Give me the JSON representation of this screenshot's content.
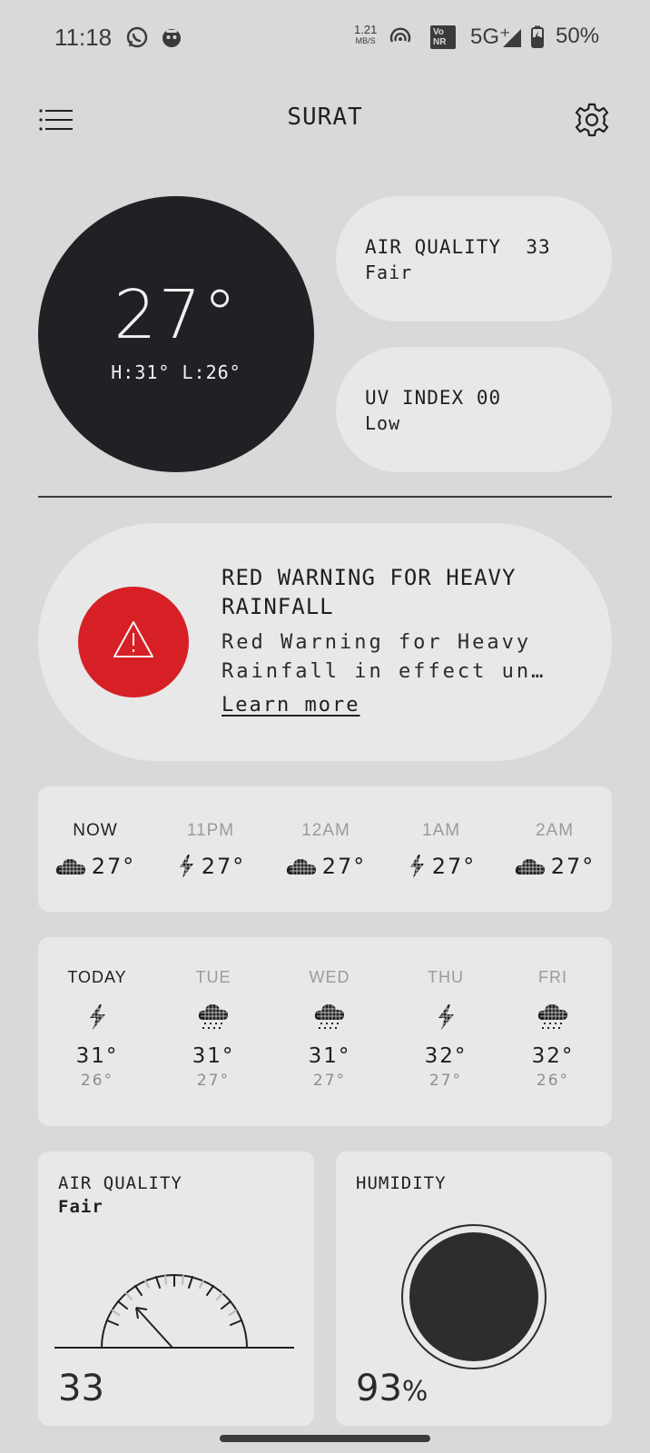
{
  "status_bar": {
    "time": "11:18",
    "speed_value": "1.21",
    "speed_unit": "MB/S",
    "vonr": "Vo\nNR",
    "network": "5G⁺",
    "battery": "50%",
    "icons": [
      "whatsapp-icon",
      "app-notification-icon",
      "hotspot-icon",
      "signal-icon",
      "battery-charging-icon"
    ]
  },
  "header": {
    "city": "SURAT",
    "menu_icon": "list-menu-icon",
    "settings_icon": "gear-icon"
  },
  "current": {
    "temp": "27°",
    "high_low": "H:31° L:26°"
  },
  "air_quality_pill": {
    "title": "AIR QUALITY",
    "value": "33",
    "status": "Fair"
  },
  "uv_pill": {
    "title": "UV INDEX",
    "value": "00",
    "status": "Low"
  },
  "warning": {
    "icon": "warning-triangle-icon",
    "title": "RED WARNING FOR HEAVY RAINFALL",
    "body": "Red Warning for Heavy Rainfall in effect un…",
    "link": "Learn more",
    "color": "#d71f26"
  },
  "hourly": [
    {
      "label": "NOW",
      "icon": "cloud-icon",
      "temp": "27°"
    },
    {
      "label": "11PM",
      "icon": "thunder-icon",
      "temp": "27°"
    },
    {
      "label": "12AM",
      "icon": "cloud-icon",
      "temp": "27°"
    },
    {
      "label": "1AM",
      "icon": "thunder-icon",
      "temp": "27°"
    },
    {
      "label": "2AM",
      "icon": "cloud-icon",
      "temp": "27°"
    }
  ],
  "daily": [
    {
      "label": "TODAY",
      "icon": "thunder-icon",
      "high": "31°",
      "low": "26°"
    },
    {
      "label": "TUE",
      "icon": "rain-cloud-icon",
      "high": "31°",
      "low": "27°"
    },
    {
      "label": "WED",
      "icon": "rain-cloud-icon",
      "high": "31°",
      "low": "27°"
    },
    {
      "label": "THU",
      "icon": "thunder-icon",
      "high": "32°",
      "low": "27°"
    },
    {
      "label": "FRI",
      "icon": "rain-cloud-icon",
      "high": "32°",
      "low": "26°"
    }
  ],
  "air_quality_card": {
    "title": "AIR QUALITY",
    "status": "Fair",
    "value": "33"
  },
  "humidity_card": {
    "title": "HUMIDITY",
    "value": "93",
    "unit": "%"
  }
}
